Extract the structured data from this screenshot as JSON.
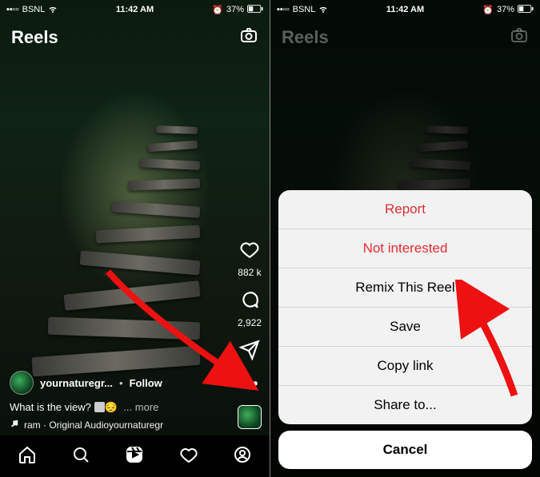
{
  "status": {
    "carrier": "BSNL",
    "time": "11:42 AM",
    "battery_pct": "37%"
  },
  "header": {
    "title": "Reels"
  },
  "actions": {
    "like_count": "882 k",
    "comment_count": "2,922"
  },
  "meta": {
    "username": "yournaturegr...",
    "follow_label": "Follow",
    "caption_prefix": "What is the view?",
    "caption_more": "more",
    "audio_text": "ram · Original Audioyournaturegr"
  },
  "sheet": {
    "items": [
      {
        "label": "Report",
        "destructive": true
      },
      {
        "label": "Not interested",
        "destructive": true
      },
      {
        "label": "Remix This Reel",
        "destructive": false
      },
      {
        "label": "Save",
        "destructive": false
      },
      {
        "label": "Copy link",
        "destructive": false
      },
      {
        "label": "Share to...",
        "destructive": false
      }
    ],
    "cancel": "Cancel"
  }
}
